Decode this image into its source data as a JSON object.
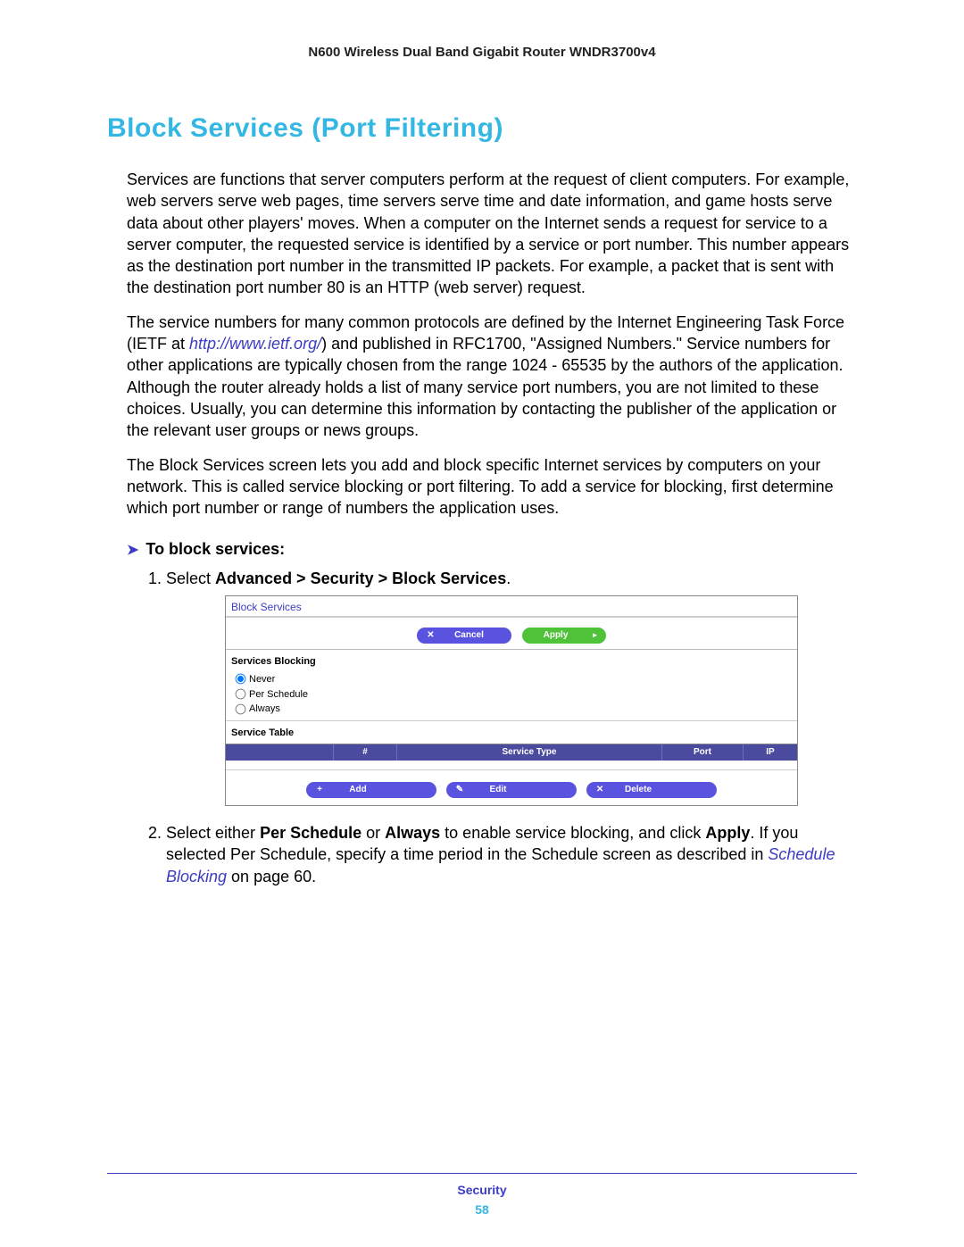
{
  "header": {
    "product_line": "N600 Wireless Dual Band Gigabit Router WNDR3700v4"
  },
  "title": "Block Services (Port Filtering)",
  "paragraphs": {
    "p1": "Services are functions that server computers perform at the request of client computers. For example, web servers serve web pages, time servers serve time and date information, and game hosts serve data about other players' moves. When a computer on the Internet sends a request for service to a server computer, the requested service is identified by a service or port number. This number appears as the destination port number in the transmitted IP packets. For example, a packet that is sent with the destination port number 80 is an HTTP (web server) request.",
    "p2a": "The service numbers for many common protocols are defined by the Internet Engineering Task Force (IETF at ",
    "p2_link": "http://www.ietf.org/",
    "p2b": ") and published in RFC1700, \"Assigned Numbers.\" Service numbers for other applications are typically chosen from the range 1024 - 65535 by the authors of the application. Although the router already holds a list of many service port numbers, you are not limited to these choices. Usually, you can determine this information by contacting the publisher of the application or the relevant user groups or news groups.",
    "p3": "The Block Services screen lets you add and block specific Internet services by computers on your network. This is called service blocking or port filtering. To add a service for blocking, first determine which port number or range of numbers the application uses."
  },
  "task": {
    "heading": "To block services:",
    "step1_prefix": "Select ",
    "step1_path": "Advanced > Security > Block Services",
    "step1_suffix": ".",
    "step2_a": "Select either ",
    "step2_b1": "Per Schedule",
    "step2_c": " or ",
    "step2_b2": "Always",
    "step2_d": " to enable service blocking, and click ",
    "step2_b3": "Apply",
    "step2_e": ". If you selected Per Schedule, specify a time period in the Schedule screen as described in ",
    "step2_link": "Schedule Blocking",
    "step2_f": " on page 60."
  },
  "ui": {
    "title": "Block Services",
    "buttons": {
      "cancel": "Cancel",
      "apply": "Apply",
      "add": "Add",
      "edit": "Edit",
      "delete": "Delete"
    },
    "services_blocking_label": "Services Blocking",
    "radios": {
      "never": "Never",
      "per_schedule": "Per Schedule",
      "always": "Always"
    },
    "service_table_label": "Service Table",
    "cols": {
      "num": "#",
      "type": "Service Type",
      "port": "Port",
      "ip": "IP"
    }
  },
  "footer": {
    "section": "Security",
    "page": "58"
  }
}
